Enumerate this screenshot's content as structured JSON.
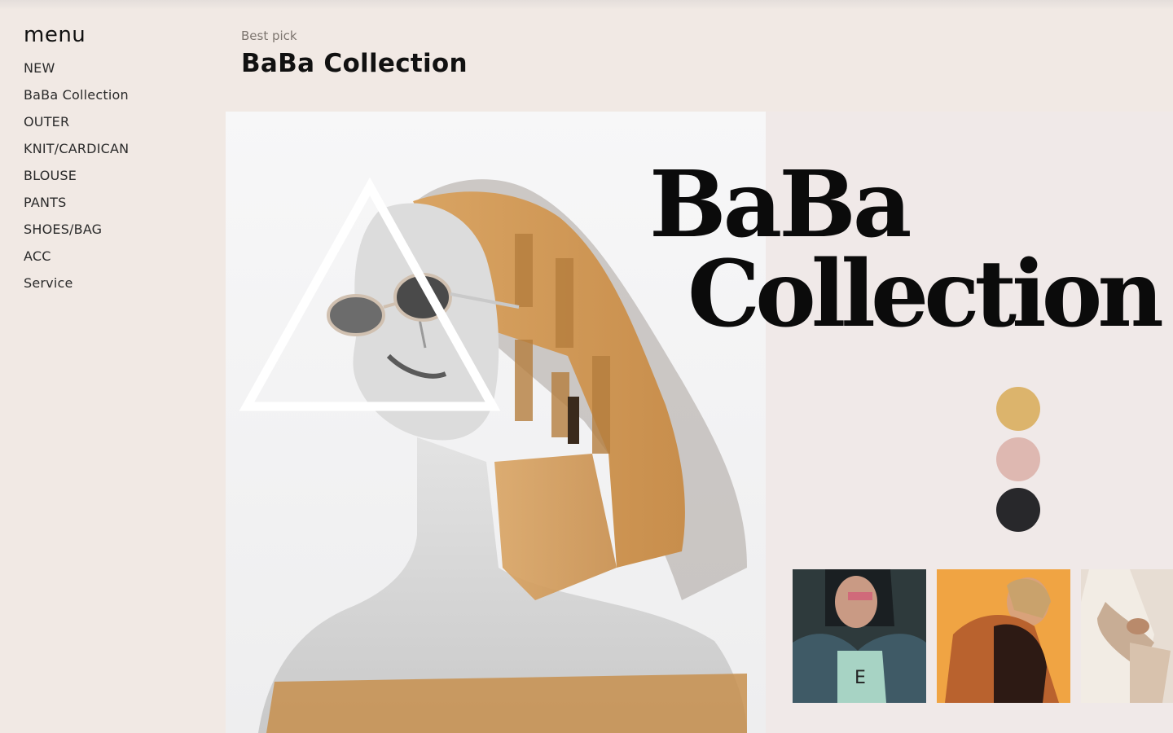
{
  "sidebar": {
    "title": "menu",
    "items": [
      {
        "label": "NEW"
      },
      {
        "label": "BaBa Collection"
      },
      {
        "label": "OUTER"
      },
      {
        "label": "KNIT/CARDICAN"
      },
      {
        "label": "BLOUSE"
      },
      {
        "label": "PANTS"
      },
      {
        "label": "SHOES/BAG"
      },
      {
        "label": "ACC"
      },
      {
        "label": "Service"
      }
    ]
  },
  "header": {
    "eyebrow": "Best pick",
    "title": "BaBa Collection"
  },
  "hero": {
    "heading_line1": "BaBa",
    "heading_line2": "Collection",
    "image_icon": "portrait-double-exposure-image"
  },
  "swatches": [
    {
      "name": "mustard",
      "color": "#dcb46c"
    },
    {
      "name": "blush",
      "color": "#deb8b1"
    },
    {
      "name": "charcoal",
      "color": "#28282b"
    }
  ],
  "thumbnails": [
    {
      "icon": "denim-jacket-photo"
    },
    {
      "icon": "orange-jacket-photo"
    },
    {
      "icon": "cream-blouse-photo"
    }
  ],
  "colors": {
    "background": "#f1e9e4",
    "stage": "#f0e9e8",
    "text": "#111111",
    "muted": "#7d756f"
  }
}
